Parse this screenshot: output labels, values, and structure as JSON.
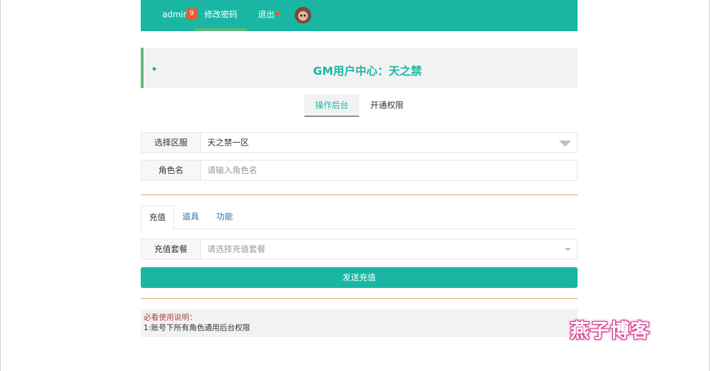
{
  "nav": {
    "user": "admin",
    "badge_count": "9",
    "change_password": "修改密码",
    "logout": "退出"
  },
  "title": "GM用户中心：天之禁",
  "main_tabs": [
    {
      "label": "操作后台",
      "active": true
    },
    {
      "label": "开通权限",
      "active": false
    }
  ],
  "form": {
    "server_label": "选择区服",
    "server_value": "天之禁一区",
    "role_label": "角色名",
    "role_placeholder": "请输入角色名"
  },
  "sub_tabs": [
    {
      "label": "充值",
      "active": true
    },
    {
      "label": "道具",
      "active": false
    },
    {
      "label": "功能",
      "active": false
    }
  ],
  "recharge": {
    "package_label": "充值套餐",
    "package_placeholder": "请选择充值套餐",
    "send_button": "发送充值"
  },
  "notes": {
    "title": "必看使用说明：",
    "lines": [
      "1:账号下所有角色通用后台权限"
    ]
  },
  "watermark": "燕子博客",
  "colors": {
    "accent": "#1ab6a3",
    "badge": "#f05a28",
    "green_bar": "#5fb878",
    "divider": "#d9a66f"
  }
}
